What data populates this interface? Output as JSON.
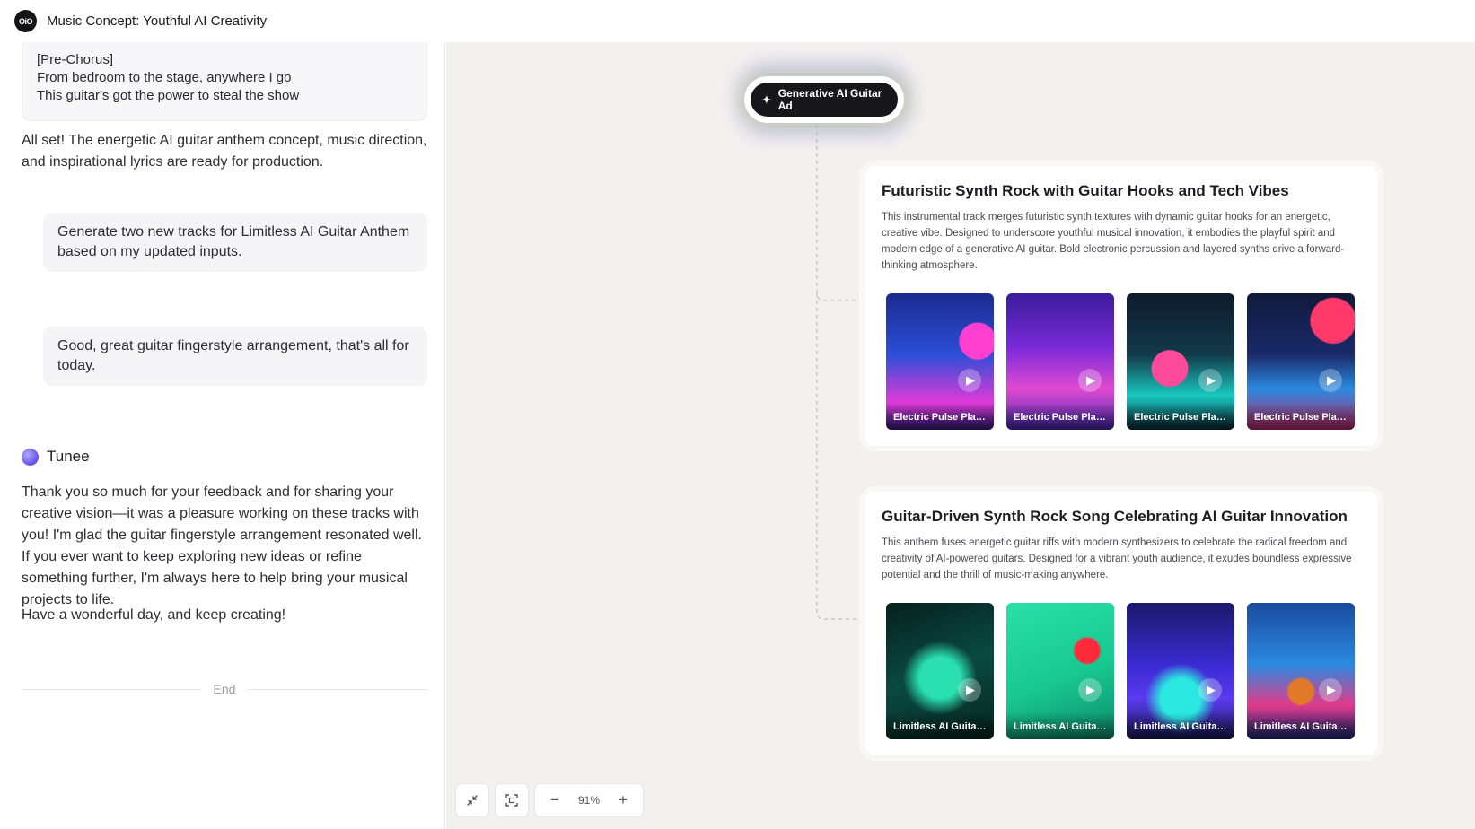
{
  "app": {
    "logo_text": "OiO",
    "title": "Music Concept: Youthful AI Creativity"
  },
  "chat": {
    "lyrics": [
      "[Pre-Chorus]",
      "From bedroom to the stage, anywhere I go",
      "This guitar's got the power to steal the show"
    ],
    "assistant_message_1": "All set! The energetic AI guitar anthem concept, music direction, and inspirational lyrics are ready for production.",
    "user_message_1": "Generate two new tracks for Limitless AI Guitar Anthem based on my updated inputs.",
    "user_message_2": "Good, great guitar fingerstyle arrangement, that's all for today.",
    "assistant_name": "Tunee",
    "assistant_message_2": "Thank you so much for your feedback and for sharing your creative vision—it was a pleasure working on these tracks with you! I'm glad the guitar fingerstyle arrangement resonated well. If you ever want to keep exploring new ideas or refine something further, I'm always here to help bring your musical projects to life.",
    "assistant_message_3": "Have a wonderful day, and keep creating!",
    "end_label": "End"
  },
  "canvas": {
    "root_node": {
      "icon": "sparkle-icon",
      "label": "Generative AI Guitar Ad"
    },
    "cards": [
      {
        "title": "Futuristic Synth Rock with Guitar Hooks and Tech Vibes",
        "description": "This instrumental track merges futuristic synth textures with dynamic guitar hooks for an energetic, creative vibe. Designed to underscore youthful musical innovation, it embodies the playful spirit and modern edge of a generative AI guitar. Bold electronic percussion and layered synths drive a forward-thinking atmosphere.",
        "tracks": [
          {
            "label": "Electric Pulse Play..."
          },
          {
            "label": "Electric Pulse Play..."
          },
          {
            "label": "Electric Pulse Play..."
          },
          {
            "label": "Electric Pulse Play..."
          }
        ]
      },
      {
        "title": "Guitar-Driven Synth Rock Song Celebrating AI Guitar Innovation",
        "description": "This anthem fuses energetic guitar riffs with modern synthesizers to celebrate the radical freedom and creativity of AI-powered guitars. Designed for a vibrant youth audience, it exudes boundless expressive potential and the thrill of music-making anywhere.",
        "tracks": [
          {
            "label": "Limitless AI Guitar ..."
          },
          {
            "label": "Limitless AI Guitar ..."
          },
          {
            "label": "Limitless AI Guitar ..."
          },
          {
            "label": "Limitless AI Guitar ..."
          }
        ]
      }
    ],
    "toolbar": {
      "collapse_icon": "collapse-arrows-icon",
      "fit_icon": "fit-screen-icon",
      "zoom_out": "−",
      "zoom_level": "91%",
      "zoom_in": "+"
    }
  },
  "colors": {
    "canvas_bg": "#f2f1ee",
    "root_node_bg": "#16161b",
    "accent_purple": "#6b5cf0"
  }
}
